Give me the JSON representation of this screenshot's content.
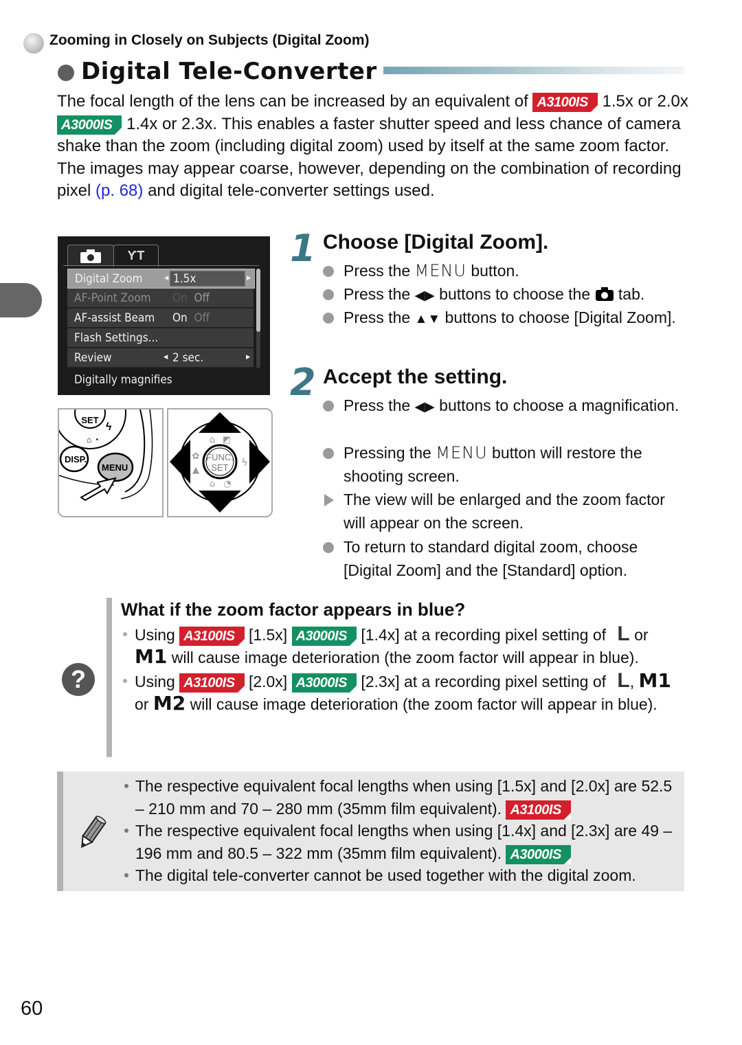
{
  "section_header": "Zooming in Closely on Subjects (Digital Zoom)",
  "page_title": "Digital Tele-Converter",
  "badges": {
    "a3100": "A3100IS",
    "a3000": "A3000IS"
  },
  "colors": {
    "badge_red": "#d41f2c",
    "badge_green": "#149062",
    "step_number": "#3d7785",
    "link": "#1f2ad8",
    "note_bg": "#e7e7e7"
  },
  "intro": {
    "p1_a": "The focal length of the lens can be increased by an equivalent of ",
    "p1_b": " 1.5x or 2.0x ",
    "p1_c": " 1.4x or 2.3x. This enables a faster shutter speed and less chance of camera shake than the zoom (including digital zoom) used by itself at the same zoom factor.",
    "p2_a": "The images may appear coarse, however, depending on the combination of recording pixel ",
    "p2_link": "(p. 68)",
    "p2_b": " and digital tele-converter settings used."
  },
  "camera_menu": {
    "tabs": [
      {
        "icon": "camera-icon"
      },
      {
        "icon": "tools-icon",
        "label": "ƳT"
      }
    ],
    "rows": [
      {
        "label": "Digital Zoom",
        "value": "1.5x",
        "selected": true
      },
      {
        "label": "AF-Point Zoom",
        "value_on": "On",
        "value_off": "Off",
        "disabled": true
      },
      {
        "label": "AF-assist Beam",
        "value_on": "On",
        "value_off": "Off"
      },
      {
        "label": "Flash Settings..."
      },
      {
        "label": "Review",
        "value": "2 sec."
      }
    ],
    "help_text": "Digitally magnifies"
  },
  "illustrations": {
    "left": {
      "buttons": [
        "FUNC.\nSET",
        "DISP.",
        "MENU"
      ]
    },
    "right": {
      "center_label_1": "FUNC.",
      "center_label_2": "SET"
    }
  },
  "steps": [
    {
      "number": "1",
      "title": "Choose [Digital Zoom].",
      "bullets": [
        {
          "type": "dot",
          "pre": "Press the ",
          "menu": "MENU",
          "post": " button."
        },
        {
          "type": "dot",
          "pre": "Press the ",
          "glyph": "◀▶",
          "mid": " buttons to choose the ",
          "icon": "camera-icon",
          "post": " tab."
        },
        {
          "type": "dot",
          "pre": "Press the ",
          "glyph": "▲▼",
          "post": " buttons to choose [Digital Zoom]."
        }
      ]
    },
    {
      "number": "2",
      "title": "Accept the setting.",
      "bullets": [
        {
          "type": "dot",
          "pre": "Press the ",
          "glyph": "◀▶",
          "post": " buttons to choose a magnification."
        },
        {
          "type": "dot",
          "pre": "Pressing the ",
          "menu": "MENU",
          "post": " button will restore the shooting screen."
        },
        {
          "type": "arrow",
          "text": "The view will be enlarged and the zoom factor will appear on the screen."
        },
        {
          "type": "dot",
          "text": "To return to standard digital zoom, choose [Digital Zoom] and the [Standard] option."
        }
      ]
    }
  ],
  "question": {
    "title": "What if the zoom factor appears in blue?",
    "items": [
      {
        "using": "Using",
        "a3100_val": "[1.5x]",
        "a3000_val": "[1.4x] at a recording pixel setting of",
        "size1": "L",
        "or": "or",
        "size2": "M1",
        "rest": "will cause image deterioration (the zoom factor will appear in blue)."
      },
      {
        "using": "Using",
        "a3100_val": "[2.0x]",
        "a3000_val": "[2.3x] at a recording pixel setting of",
        "size1": "L",
        "comma": ",",
        "size2": "M1",
        "or": "or",
        "size3": "M2",
        "rest": "will cause image deterioration (the zoom factor will appear in blue)."
      }
    ]
  },
  "notes": [
    {
      "text": "The respective equivalent focal lengths when using [1.5x] and [2.0x] are 52.5 – 210 mm and 70 – 280 mm (35mm film equivalent).",
      "badge": "A3100IS"
    },
    {
      "text": "The respective equivalent focal lengths when using [1.4x] and [2.3x] are 49 – 196 mm and 80.5 – 322 mm (35mm film equivalent).",
      "badge": "A3000IS"
    },
    {
      "text": "The digital tele-converter cannot be used together with the digital zoom."
    }
  ],
  "page_number": "60"
}
